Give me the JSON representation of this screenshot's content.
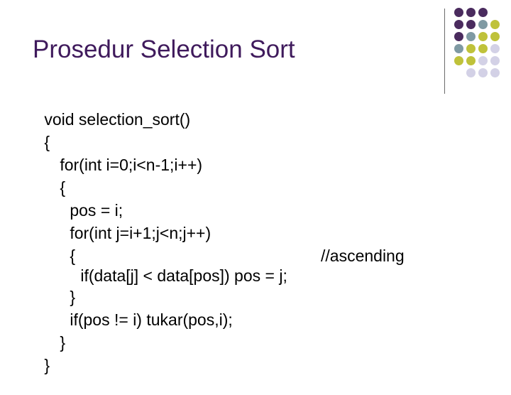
{
  "slide": {
    "title": "Prosedur Selection Sort",
    "code": {
      "line1": {
        "kw": "void",
        "rest": " selection_sort()"
      },
      "line2": {
        "text": "{"
      },
      "line3": {
        "kw": "for(int",
        "rest": " i=0;i<n-1;i++)"
      },
      "line4": {
        "text": "{"
      },
      "line5": {
        "text": "pos = i;"
      },
      "line6": {
        "kw": "for(int j",
        "rest": "=i+1;j<n;j++)"
      },
      "line7": {
        "text": "{"
      },
      "line8": {
        "kw": "if",
        "rest": "(data[j] < data[pos]) pos = j;",
        "comment": "//ascending"
      },
      "line9": {
        "text": "}"
      },
      "line10": {
        "kw": "if",
        "rest": "(pos != i) tukar(pos,i);"
      },
      "line11": {
        "text": "}"
      },
      "line12": {
        "text": "}"
      }
    },
    "decoration": {
      "colors": {
        "purple": "#4a2b5e",
        "teal": "#7f9aa3",
        "olive": "#bfc23a",
        "lavender": "#d3d1e6"
      }
    }
  }
}
